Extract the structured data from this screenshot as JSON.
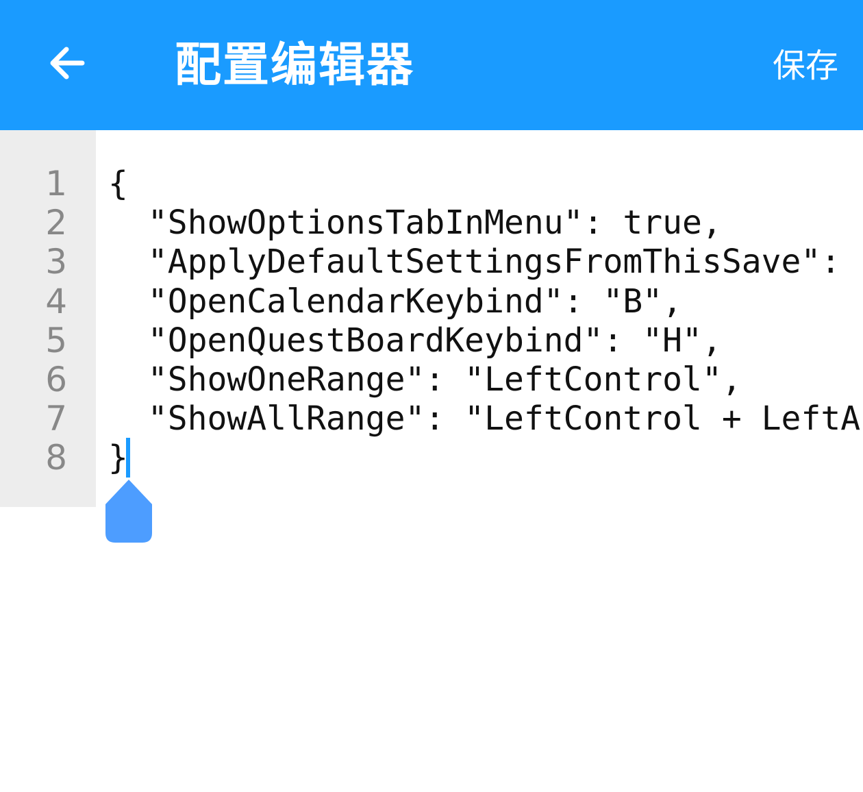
{
  "header": {
    "back_icon": "arrow-left-icon",
    "title": "配置编辑器",
    "save_label": "保存",
    "background_color": "#1a9bff",
    "text_color": "#ffffff"
  },
  "editor": {
    "gutter_color": "#ededed",
    "line_numbers": [
      "1",
      "2",
      "3",
      "4",
      "5",
      "6",
      "7",
      "8"
    ],
    "lines": [
      "{",
      "  \"ShowOptionsTabInMenu\": true,",
      "  \"ApplyDefaultSettingsFromThisSave\":",
      "  \"OpenCalendarKeybind\": \"B\",",
      "  \"OpenQuestBoardKeybind\": \"H\",",
      "  \"ShowOneRange\": \"LeftControl\",",
      "  \"ShowAllRange\": \"LeftControl + LeftA",
      "}"
    ],
    "cursor": {
      "line": 8,
      "column": 2,
      "handle_icon": "text-cursor-handle-icon",
      "color": "#1a9bff"
    }
  }
}
